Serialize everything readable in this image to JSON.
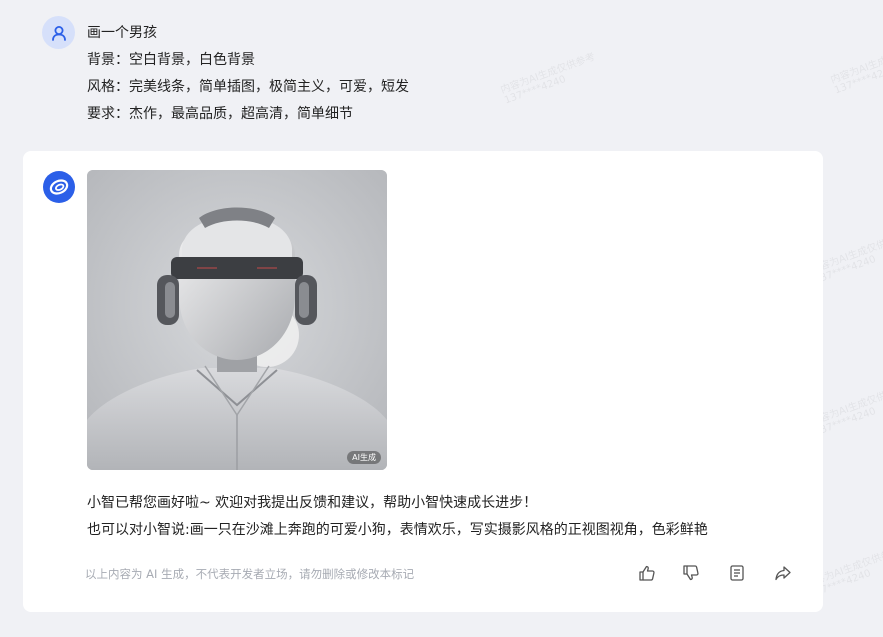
{
  "user_message": {
    "lines": [
      "画一个男孩",
      "背景：空白背景，白色背景",
      "风格：完美线条，简单插图，极简主义，可爱，短发",
      "要求：杰作，最高品质，超高清，简单细节"
    ]
  },
  "bot_message": {
    "image_badge": "AI生成",
    "reply_lines": [
      "小智已帮您画好啦~ 欢迎对我提出反馈和建议，帮助小智快速成长进步！",
      "也可以对小智说:画一只在沙滩上奔跑的可爱小狗，表情欢乐，写实摄影风格的正视图视角，色彩鲜艳"
    ],
    "disclaimer": "以上内容为 AI 生成，不代表开发者立场，请勿删除或修改本标记"
  },
  "watermark": {
    "line1": "内容为AI生成仅供参考",
    "line2": "137****4240"
  },
  "colors": {
    "page_bg": "#f0f1f5",
    "card_bg": "#ffffff",
    "brand_blue": "#2b5fe8",
    "user_avatar_bg": "#d6e0fa"
  }
}
